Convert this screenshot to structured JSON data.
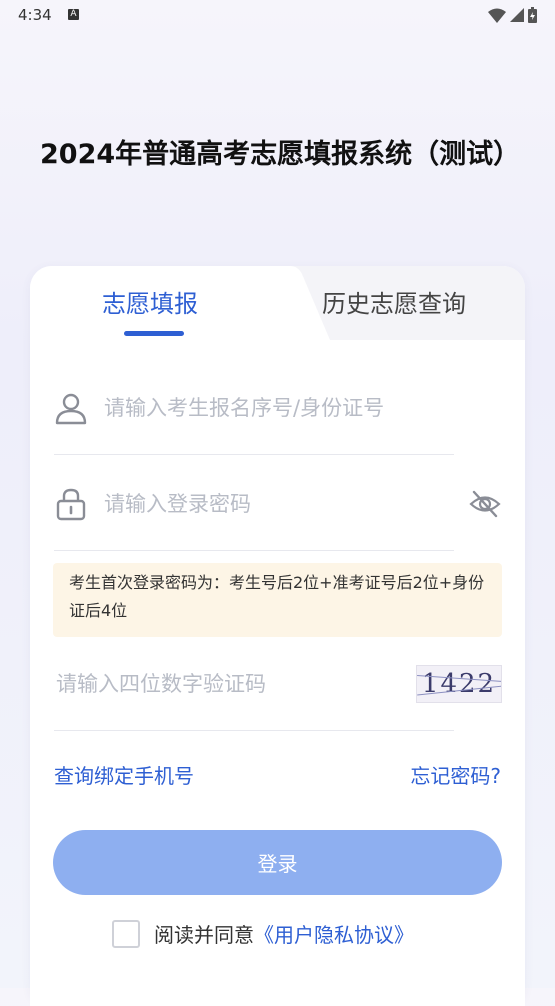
{
  "status_bar": {
    "time": "4:34",
    "badge": "A"
  },
  "page": {
    "title": "2024年普通高考志愿填报系统（测试）"
  },
  "tabs": [
    {
      "label": "志愿填报",
      "active": true
    },
    {
      "label": "历史志愿查询",
      "active": false
    }
  ],
  "form": {
    "username_placeholder": "请输入考生报名序号/身份证号",
    "password_placeholder": "请输入登录密码",
    "notice": "考生首次登录密码为：考生号后2位+准考证号后2位+身份证后4位",
    "captcha_placeholder": "请输入四位数字验证码",
    "captcha_value": "1422"
  },
  "links": {
    "bind_phone": "查询绑定手机号",
    "forgot_password": "忘记密码?"
  },
  "login_button": "登录",
  "agreement": {
    "text": "阅读并同意",
    "link": "《用户隐私协议》"
  },
  "colors": {
    "accent": "#2e5fd3",
    "button": "#8eaff0",
    "notice_bg": "#fdf5e6"
  }
}
